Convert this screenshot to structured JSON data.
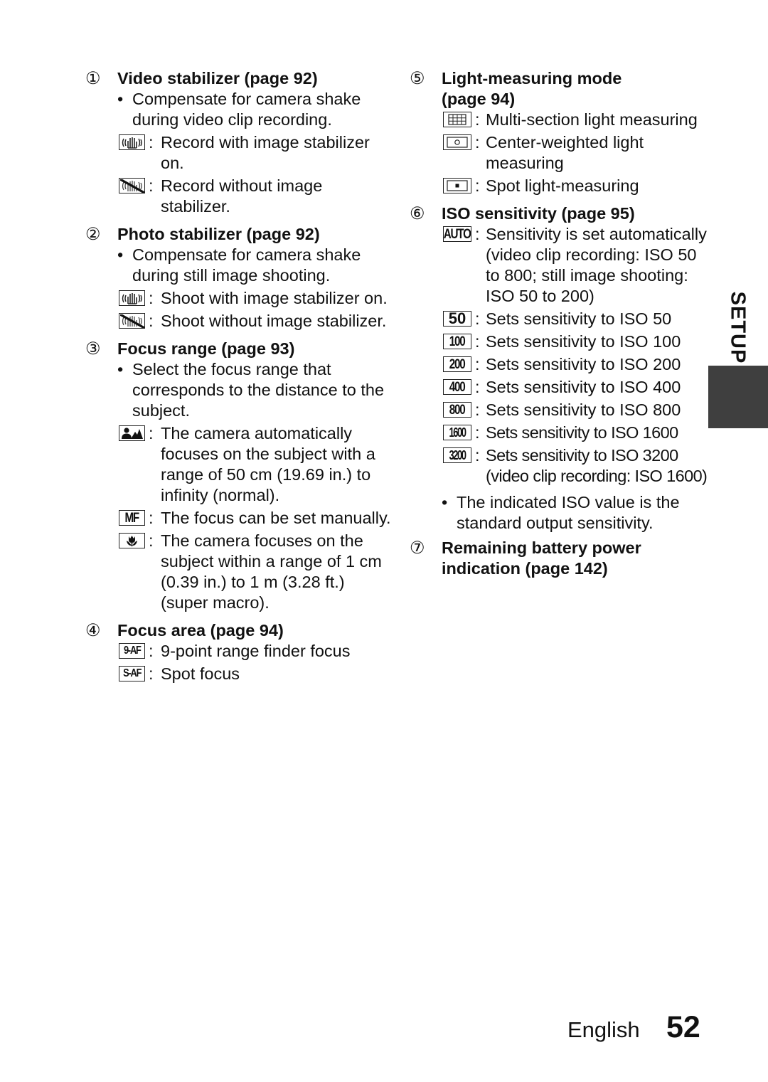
{
  "side_tab": {
    "label": "SETUP",
    "color": "#3f3f3f"
  },
  "footer": {
    "language": "English",
    "page_number": "52"
  },
  "left": {
    "s1": {
      "num": "①",
      "title": "Video stabilizer (page 92)",
      "bullet": "Compensate for camera shake during video clip recording.",
      "items": [
        {
          "icon": "stabilizer-on-icon",
          "text": "Record with image stabilizer on."
        },
        {
          "icon": "stabilizer-off-icon",
          "text": "Record without image stabilizer."
        }
      ]
    },
    "s2": {
      "num": "②",
      "title": "Photo stabilizer (page 92)",
      "bullet": "Compensate for camera shake during still image shooting.",
      "items": [
        {
          "icon": "stabilizer-on-icon",
          "text": "Shoot with image stabilizer on."
        },
        {
          "icon": "stabilizer-off-icon",
          "text": "Shoot without image stabilizer."
        }
      ]
    },
    "s3": {
      "num": "③",
      "title": "Focus range (page 93)",
      "bullet": "Select the focus range that corresponds to the distance to the subject.",
      "items": [
        {
          "icon": "normal-focus-icon",
          "text": "The camera automatically focuses on the subject with a range of 50 cm (19.69 in.) to infinity (normal)."
        },
        {
          "icon": "manual-focus-icon",
          "icon_text": "MF",
          "text": "The focus can be set manually."
        },
        {
          "icon": "super-macro-icon",
          "text": "The camera focuses on the subject within a range of 1 cm (0.39 in.) to 1 m (3.28 ft.) (super macro)."
        }
      ]
    },
    "s4": {
      "num": "④",
      "title": "Focus area (page 94)",
      "items": [
        {
          "icon": "nine-point-af-icon",
          "icon_text": "9-AF",
          "text": "9-point range finder focus"
        },
        {
          "icon": "spot-af-icon",
          "icon_text": "S-AF",
          "text": "Spot focus"
        }
      ]
    }
  },
  "right": {
    "s5": {
      "num": "⑤",
      "title": "Light-measuring mode (page 94)",
      "items": [
        {
          "icon": "multi-section-metering-icon",
          "text": "Multi-section light measuring"
        },
        {
          "icon": "center-weighted-metering-icon",
          "text": "Center-weighted light measuring"
        },
        {
          "icon": "spot-metering-icon",
          "text": "Spot light-measuring"
        }
      ]
    },
    "s6": {
      "num": "⑥",
      "title": "ISO sensitivity (page 95)",
      "items": [
        {
          "icon": "iso-auto-icon",
          "icon_text": "AUTO",
          "text": "Sensitivity is set automatically (video clip recording: ISO 50 to 800; still image shooting: ISO 50 to 200)"
        },
        {
          "icon": "iso-50-icon",
          "icon_text": "50",
          "text": "Sets sensitivity to ISO 50"
        },
        {
          "icon": "iso-100-icon",
          "icon_text": "100",
          "text": "Sets sensitivity to ISO 100"
        },
        {
          "icon": "iso-200-icon",
          "icon_text": "200",
          "text": "Sets sensitivity to ISO 200"
        },
        {
          "icon": "iso-400-icon",
          "icon_text": "400",
          "text": "Sets sensitivity to ISO 400"
        },
        {
          "icon": "iso-800-icon",
          "icon_text": "800",
          "text": "Sets sensitivity to ISO 800"
        },
        {
          "icon": "iso-1600-icon",
          "icon_text": "1600",
          "text": "Sets sensitivity to ISO 1600"
        },
        {
          "icon": "iso-3200-icon",
          "icon_text": "3200",
          "text": "Sets sensitivity to ISO 3200 (video clip recording: ISO 1600)"
        }
      ],
      "bullet": "The indicated ISO value is the standard output sensitivity."
    },
    "s7": {
      "num": "⑦",
      "title": "Remaining battery power indication (page 142)"
    }
  }
}
